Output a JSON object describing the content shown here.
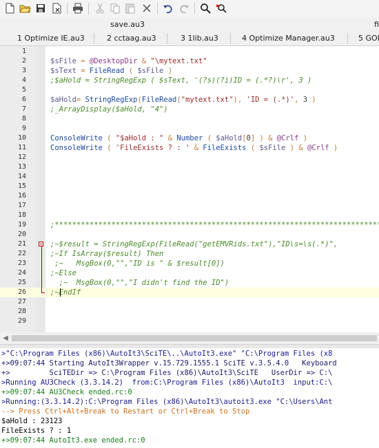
{
  "toolbar": {
    "buttons": [
      "new-file-icon",
      "open-folder-icon",
      "save-icon",
      "close-file-icon",
      "print-icon",
      "cut-icon",
      "copy-icon",
      "paste-icon",
      "delete-icon",
      "undo-icon",
      "redo-icon",
      "find-icon",
      "replace-icon"
    ]
  },
  "file_tabs": {
    "active": "save.au3",
    "next": "fi"
  },
  "buffer_tabs": [
    "1 Optimize IE.au3",
    "2 cctaag.au3",
    "3 1lib.au3",
    "4 Optimize Manager.au3",
    "5 GOL"
  ],
  "editor": {
    "lines": [
      {
        "n": "1",
        "segments": []
      },
      {
        "n": "2",
        "segments": [
          {
            "t": "$sFile",
            "c": "var"
          },
          {
            "t": " = ",
            "c": "op"
          },
          {
            "t": "@DesktopDir",
            "c": "macro"
          },
          {
            "t": " & ",
            "c": "op"
          },
          {
            "t": "\"\\mytext.txt\"",
            "c": "str"
          }
        ]
      },
      {
        "n": "3",
        "segments": [
          {
            "t": "$sText",
            "c": "var"
          },
          {
            "t": " = ",
            "c": "op"
          },
          {
            "t": "FileRead",
            "c": "func"
          },
          {
            "t": " ( ",
            "c": "op"
          },
          {
            "t": "$sFile",
            "c": "var"
          },
          {
            "t": " )",
            "c": "op"
          }
        ]
      },
      {
        "n": "4",
        "segments": [
          {
            "t": ";$aHold = StringRegExp ( $sText, '(?s)(?i)ID = (.*?)\\r', 3 )",
            "c": "com"
          }
        ]
      },
      {
        "n": "5",
        "segments": []
      },
      {
        "n": "6",
        "segments": [
          {
            "t": "$aHold",
            "c": "var"
          },
          {
            "t": "= ",
            "c": "op"
          },
          {
            "t": "StringRegExp",
            "c": "func"
          },
          {
            "t": "(",
            "c": "op"
          },
          {
            "t": "FileRead",
            "c": "func"
          },
          {
            "t": "(",
            "c": "op"
          },
          {
            "t": "\"mytext.txt\"",
            "c": "str"
          },
          {
            "t": "), ",
            "c": "op"
          },
          {
            "t": "'ID = (.*)'",
            "c": "str"
          },
          {
            "t": ", ",
            "c": "op"
          },
          {
            "t": "3",
            "c": "num"
          },
          {
            "t": " )",
            "c": "op"
          }
        ]
      },
      {
        "n": "7",
        "segments": [
          {
            "t": ";_ArrayDisplay($aHold, \"4\")",
            "c": "com"
          }
        ]
      },
      {
        "n": "8",
        "segments": []
      },
      {
        "n": "9",
        "segments": []
      },
      {
        "n": "10",
        "segments": [
          {
            "t": "ConsoleWrite",
            "c": "func"
          },
          {
            "t": " ( ",
            "c": "op"
          },
          {
            "t": "\"$aHold : \"",
            "c": "str"
          },
          {
            "t": " & ",
            "c": "op"
          },
          {
            "t": "Number",
            "c": "func"
          },
          {
            "t": " ( ",
            "c": "op"
          },
          {
            "t": "$aHold",
            "c": "var"
          },
          {
            "t": "[",
            "c": "op"
          },
          {
            "t": "0",
            "c": "num"
          },
          {
            "t": "] ) & ",
            "c": "op"
          },
          {
            "t": "@Crlf",
            "c": "macro"
          },
          {
            "t": " )",
            "c": "op"
          }
        ]
      },
      {
        "n": "11",
        "segments": [
          {
            "t": "ConsoleWrite",
            "c": "func"
          },
          {
            "t": " ( ",
            "c": "op"
          },
          {
            "t": "'FileExists ? : '",
            "c": "str"
          },
          {
            "t": " & ",
            "c": "op"
          },
          {
            "t": "FileExists",
            "c": "func"
          },
          {
            "t": " ( ",
            "c": "op"
          },
          {
            "t": "$sFile",
            "c": "var"
          },
          {
            "t": " ) & ",
            "c": "op"
          },
          {
            "t": "@Crlf",
            "c": "macro"
          },
          {
            "t": " )",
            "c": "op"
          }
        ]
      },
      {
        "n": "12",
        "segments": []
      },
      {
        "n": "13",
        "segments": []
      },
      {
        "n": "14",
        "segments": []
      },
      {
        "n": "15",
        "segments": []
      },
      {
        "n": "16",
        "segments": []
      },
      {
        "n": "17",
        "segments": []
      },
      {
        "n": "18",
        "segments": []
      },
      {
        "n": "19",
        "segments": [
          {
            "t": ";*****************************************************************************",
            "c": "com"
          }
        ]
      },
      {
        "n": "20",
        "segments": []
      },
      {
        "n": "21",
        "segments": [
          {
            "t": ";~$result = StringRegExp(FileRead(\"getEMVRids.txt\"),\"ID\\s=\\s(.*)\",",
            "c": "com"
          }
        ]
      },
      {
        "n": "22",
        "segments": [
          {
            "t": ";~If IsArray($result) Then",
            "c": "com"
          }
        ]
      },
      {
        "n": "23",
        "segments": [
          {
            "t": " ;~   MsgBox(0,\"\",\"ID is \" & $result[0])",
            "c": "com"
          }
        ]
      },
      {
        "n": "24",
        "segments": [
          {
            "t": ";~Else",
            "c": "com"
          }
        ]
      },
      {
        "n": "25",
        "segments": [
          {
            "t": "  ;~  MsgBox(0,\"\",\"I didn't find the ID\")",
            "c": "com"
          }
        ]
      },
      {
        "n": "26",
        "segments": [
          {
            "t": ";~EndIf",
            "c": "com"
          }
        ]
      },
      {
        "n": "27",
        "segments": []
      },
      {
        "n": "28",
        "segments": []
      },
      {
        "n": "29",
        "segments": []
      }
    ]
  },
  "output": {
    "lines": [
      {
        "t": ">\"C:\\Program Files (x86)\\AutoIt3\\SciTE\\..\\AutoIt3.exe\" \"C:\\Program Files (x8",
        "c": "cmd"
      },
      {
        "t": "+>09:07:44 Starting AutoIt3Wrapper v.15.729.1555.1 SciTE v.3.5.4.0   Keyboard",
        "c": "info"
      },
      {
        "t": "+>         SciTEDir => C:\\Program Files (x86)\\AutoIt3\\SciTE   UserDir => C:\\",
        "c": "info"
      },
      {
        "t": ">Running AU3Check (3.3.14.2)  from:C:\\Program Files (x86)\\AutoIt3  input:C:\\",
        "c": "cmd"
      },
      {
        "t": "+>09:07:44 AU3Check ended.rc:0",
        "c": "green"
      },
      {
        "t": ">Running:(3.3.14.2):C:\\Program Files (x86)\\AutoIt3\\autoit3.exe \"C:\\Users\\Ant",
        "c": "cmd"
      },
      {
        "t": "--> Press Ctrl+Alt+Break to Restart or Ctrl+Break to Stop",
        "c": "orange"
      },
      {
        "t": "$aHold : 23123",
        "c": "black"
      },
      {
        "t": "FileExists ? : 1",
        "c": "black"
      },
      {
        "t": "+>09:07:44 AutoIt3.exe ended.rc:0",
        "c": "green"
      }
    ]
  }
}
